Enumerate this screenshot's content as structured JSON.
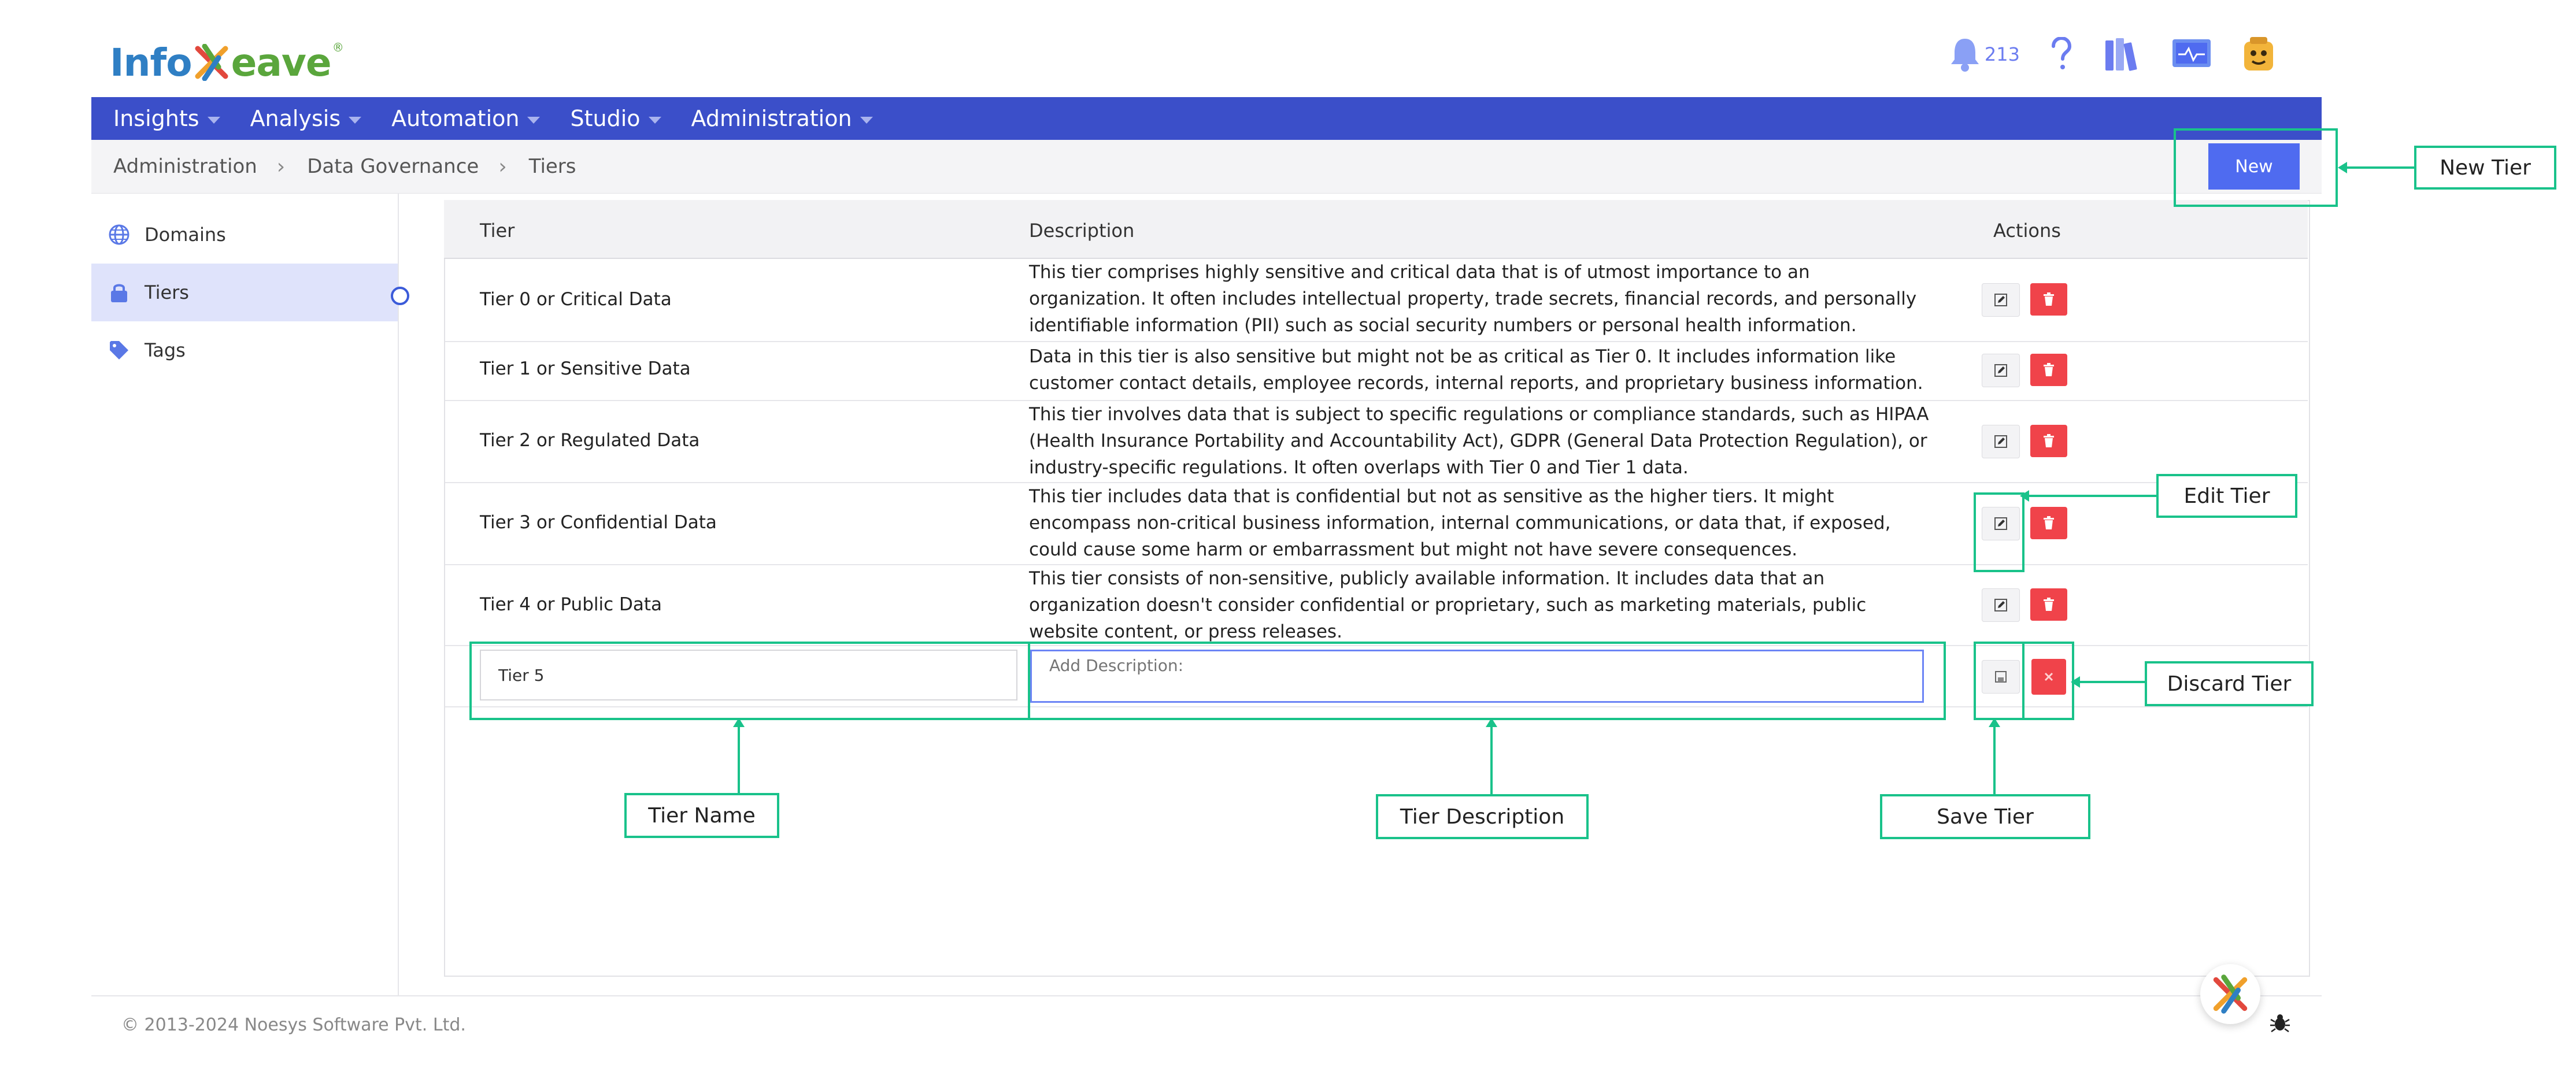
{
  "header": {
    "logo_text_info": "Info",
    "logo_text_weave": "eave",
    "logo_reg": "®",
    "notifications_count": "213"
  },
  "nav": {
    "items": [
      {
        "label": "Insights"
      },
      {
        "label": "Analysis"
      },
      {
        "label": "Automation"
      },
      {
        "label": "Studio"
      },
      {
        "label": "Administration"
      }
    ]
  },
  "breadcrumb": [
    "Administration",
    "Data Governance",
    "Tiers"
  ],
  "new_button_label": "New",
  "sidebar": {
    "items": [
      {
        "label": "Domains",
        "icon": "globe-icon"
      },
      {
        "label": "Tiers",
        "icon": "lock-icon",
        "active": true
      },
      {
        "label": "Tags",
        "icon": "tag-icon"
      }
    ]
  },
  "table": {
    "headers": {
      "tier": "Tier",
      "description": "Description",
      "actions": "Actions"
    },
    "rows": [
      {
        "tier": "Tier 0 or Critical Data",
        "description": "This tier comprises highly sensitive and critical data that is of utmost importance to an organization. It often includes intellectual property, trade secrets, financial records, and personally identifiable information (PII) such as social security numbers or personal health information."
      },
      {
        "tier": "Tier 1 or Sensitive Data",
        "description": "Data in this tier is also sensitive but might not be as critical as Tier 0. It includes information like customer contact details, employee records, internal reports, and proprietary business information."
      },
      {
        "tier": "Tier 2 or Regulated Data",
        "description": "This tier involves data that is subject to specific regulations or compliance standards, such as HIPAA (Health Insurance Portability and Accountability Act), GDPR (General Data Protection Regulation), or industry-specific regulations. It often overlaps with Tier 0 and Tier 1 data."
      },
      {
        "tier": "Tier 3 or Confidential Data",
        "description": "This tier includes data that is confidential but not as sensitive as the higher tiers. It might encompass non-critical business information, internal communications, or data that, if exposed, could cause some harm or embarrassment but might not have severe consequences."
      },
      {
        "tier": "Tier 4 or Public Data",
        "description": "This tier consists of non-sensitive, publicly available information. It includes data that an organization doesn't consider confidential or proprietary, such as marketing materials, public website content, or press releases."
      }
    ],
    "new_row": {
      "tier_value": "Tier 5",
      "description_placeholder": "Add Description:"
    }
  },
  "callouts": {
    "new_tier": "New Tier",
    "edit_tier": "Edit Tier",
    "discard_tier": "Discard Tier",
    "tier_name": "Tier Name",
    "tier_description": "Tier Description",
    "save_tier": "Save Tier"
  },
  "footer": {
    "copyright": "© 2013-2024 Noesys Software Pvt. Ltd."
  },
  "colors": {
    "nav": "#3b4fc9",
    "new_button": "#4f6bf0",
    "delete": "#f0434a",
    "callout": "#19c28a",
    "sidebar_active": "#dfe3fb"
  }
}
